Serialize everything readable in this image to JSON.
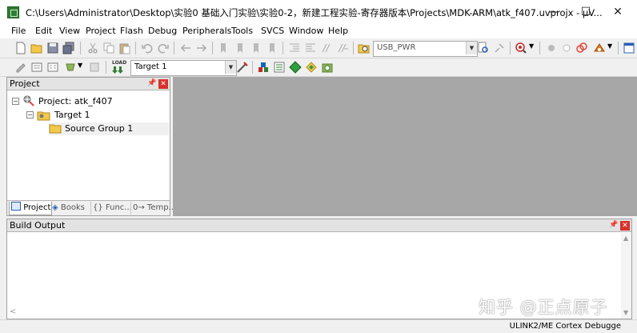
{
  "window": {
    "title": "C:\\Users\\Administrator\\Desktop\\实验0 基础入门实验\\实验0-2，新建工程实验-寄存器版本\\Projects\\MDK-ARM\\atk_f407.uvprojx - µV...",
    "minimize": "—",
    "maximize": "☐",
    "close": "✕"
  },
  "menu": [
    "File",
    "Edit",
    "View",
    "Project",
    "Flash",
    "Debug",
    "Peripherals",
    "Tools",
    "SVCS",
    "Window",
    "Help"
  ],
  "toolbar1": {
    "combo_value": "USB_PWR"
  },
  "toolbar2": {
    "target_value": "Target 1",
    "load_label": "LOAD"
  },
  "project_panel": {
    "title": "Project",
    "tree": {
      "project": "Project: atk_f407",
      "target": "Target 1",
      "group": "Source Group 1"
    },
    "tabs": [
      "Project",
      "Books",
      "{} Func...",
      "0→ Temp..."
    ]
  },
  "build_output": {
    "title": "Build Output"
  },
  "status_bar": {
    "debugger": "ULINK2/ME Cortex Debugge"
  },
  "watermark": "知乎 @正点原子",
  "colors": {
    "editor_bg": "#a7a7a7",
    "close_red": "#d9312b",
    "folder_yellow": "#f3c84b"
  }
}
